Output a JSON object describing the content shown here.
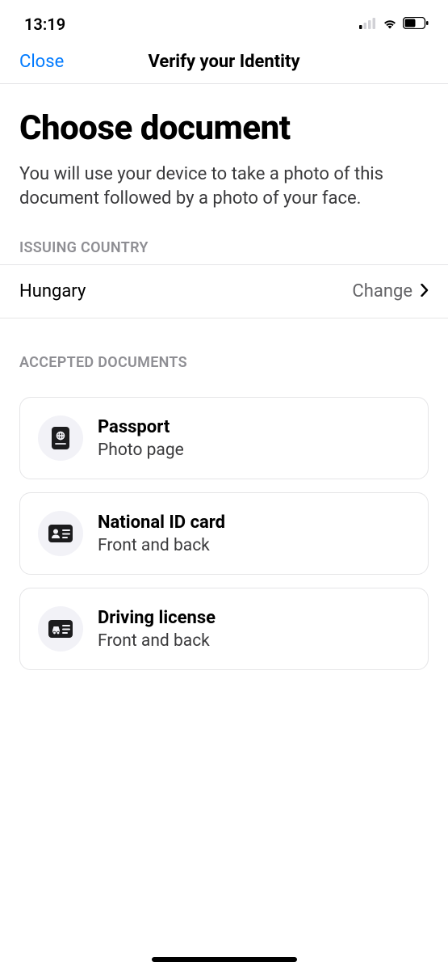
{
  "status_bar": {
    "time": "13:19"
  },
  "nav": {
    "close": "Close",
    "title": "Verify your Identity"
  },
  "header": {
    "title": "Choose document",
    "subtitle": "You will use your device to take a photo of this document followed by a photo of your face."
  },
  "issuing_country": {
    "label": "ISSUING COUNTRY",
    "value": "Hungary",
    "change_label": "Change"
  },
  "accepted_documents": {
    "label": "ACCEPTED DOCUMENTS",
    "items": [
      {
        "title": "Passport",
        "subtitle": "Photo page"
      },
      {
        "title": "National ID card",
        "subtitle": "Front and back"
      },
      {
        "title": "Driving license",
        "subtitle": "Front and back"
      }
    ]
  }
}
